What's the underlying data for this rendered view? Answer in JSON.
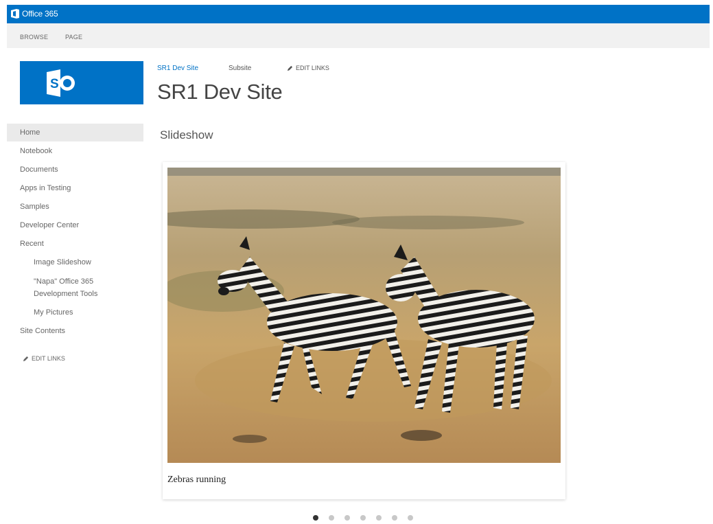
{
  "suite_bar": {
    "title": "Office 365",
    "color": "#0072c6"
  },
  "ribbon": {
    "tabs": [
      "BROWSE",
      "PAGE"
    ]
  },
  "top_nav": {
    "site_link": "SR1 Dev Site",
    "subsite_link": "Subsite",
    "edit_links": "EDIT LINKS"
  },
  "page_title": "SR1 Dev Site",
  "left_nav": {
    "items": [
      "Home",
      "Notebook",
      "Documents",
      "Apps in Testing",
      "Samples",
      "Developer Center",
      "Recent"
    ],
    "recent_items": [
      "Image Slideshow",
      "\"Napa\" Office 365",
      "Development Tools",
      "My Pictures"
    ],
    "site_contents": "Site Contents",
    "edit_links": "EDIT LINKS"
  },
  "main": {
    "section_title": "Slideshow",
    "slide": {
      "image": "zebras-photo",
      "caption": "Zebras running"
    },
    "pager": {
      "count": 7,
      "active_index": 0
    }
  }
}
